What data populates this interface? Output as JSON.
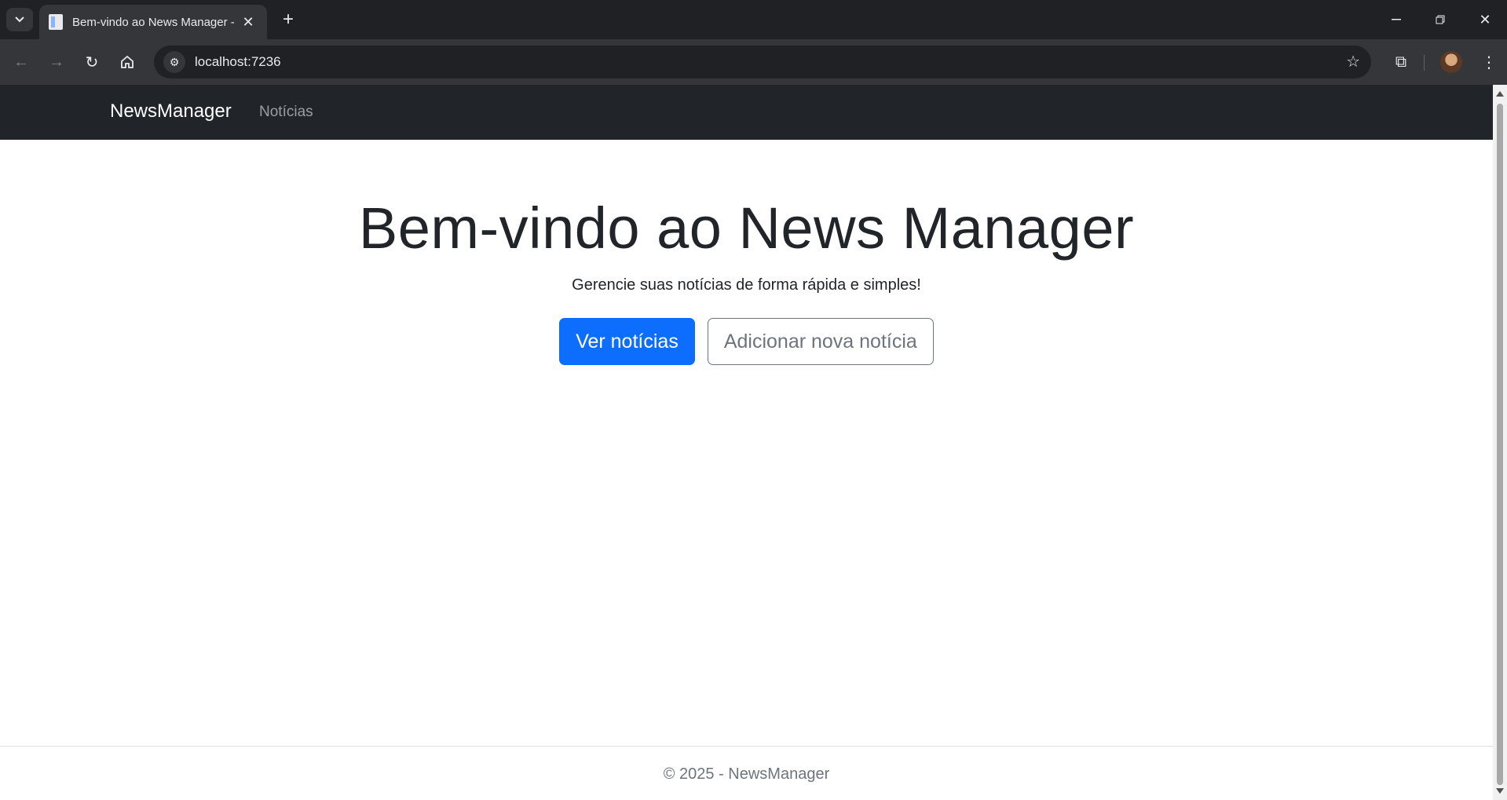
{
  "browser": {
    "tab_title": "Bem-vindo ao News Manager - ",
    "url": "localhost:7236"
  },
  "site": {
    "brand": "NewsManager",
    "nav_link": "Notícias"
  },
  "hero": {
    "title": "Bem-vindo ao News Manager",
    "subtitle": "Gerencie suas notícias de forma rápida e simples!",
    "primary_button": "Ver notícias",
    "secondary_button": "Adicionar nova notícia"
  },
  "footer": {
    "text": "© 2025 - NewsManager"
  },
  "colors": {
    "navbar": "#212529",
    "primary": "#0d6efd",
    "secondary": "#6c757d"
  }
}
